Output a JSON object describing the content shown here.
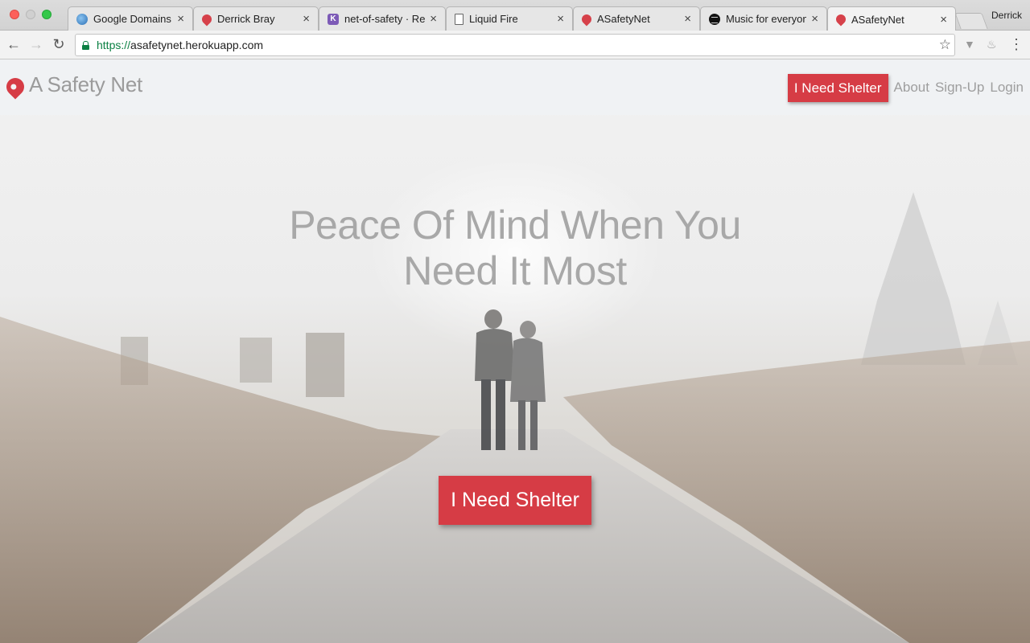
{
  "browser": {
    "tabs": [
      {
        "title": "Google Domains",
        "icon": "globe-icon",
        "active": false
      },
      {
        "title": "Derrick Bray",
        "icon": "pin-icon",
        "active": false
      },
      {
        "title": "net-of-safety · Re:",
        "icon": "k-icon",
        "active": false
      },
      {
        "title": "Liquid Fire",
        "icon": "document-icon",
        "active": false
      },
      {
        "title": "ASafetyNet",
        "icon": "pin-icon",
        "active": false
      },
      {
        "title": "Music for everyone",
        "icon": "spotify-icon",
        "active": false
      },
      {
        "title": "ASafetyNet",
        "icon": "pin-icon",
        "active": true
      }
    ],
    "close_glyph": "×",
    "profile_name": "Derrick",
    "url_scheme": "https://",
    "url_host": "asafetynet.herokuapp.com",
    "back_glyph": "←",
    "forward_glyph": "→",
    "reload_glyph": "↻",
    "star_glyph": "☆",
    "menu_glyph": "⋮"
  },
  "site": {
    "brand": "A Safety Net",
    "nav": {
      "cta": "I Need Shelter",
      "links": [
        "About",
        "Sign-Up",
        "Login"
      ]
    },
    "hero": {
      "line1": "Peace Of Mind When You",
      "line2": "Need It Most",
      "cta": "I Need Shelter"
    }
  },
  "colors": {
    "accent": "#d63c45",
    "muted_text": "#9e9e9e",
    "url_green": "#0b8043"
  }
}
